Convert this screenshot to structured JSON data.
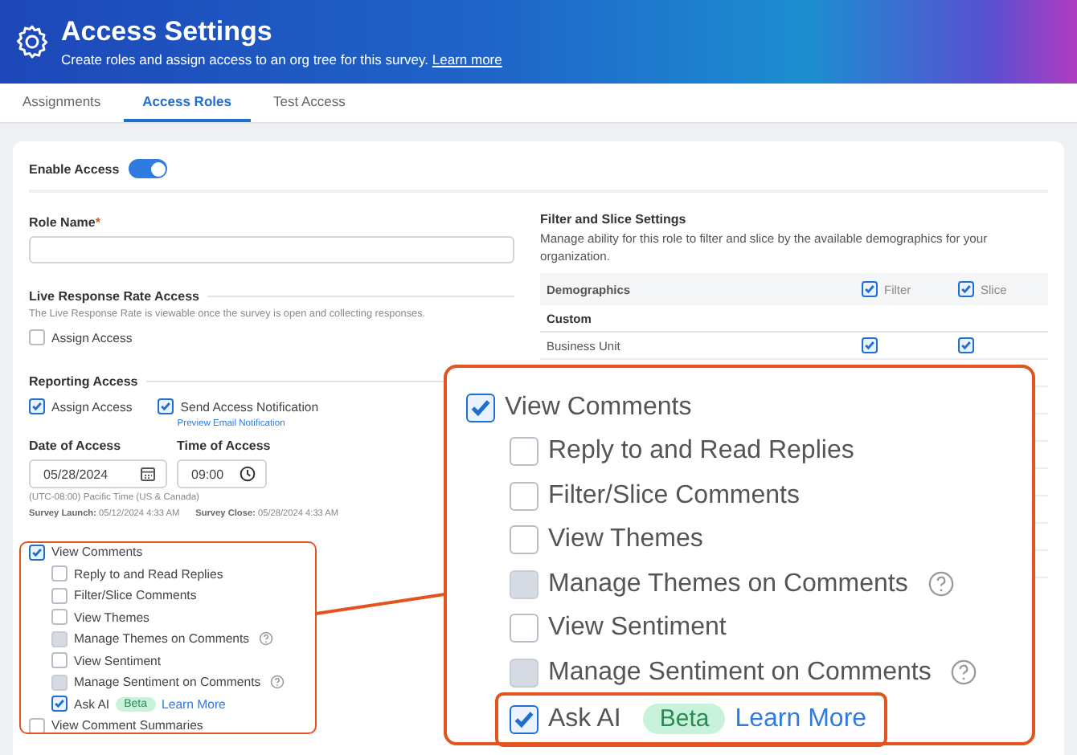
{
  "header": {
    "title": "Access Settings",
    "subtitle": "Create roles and assign access to an org tree for this survey.",
    "link": "Learn more"
  },
  "tabs": [
    {
      "label": "Assignments",
      "selected": false
    },
    {
      "label": "Access Roles",
      "selected": true
    },
    {
      "label": "Test Access",
      "selected": false
    }
  ],
  "enable_access": {
    "label": "Enable Access",
    "on": true
  },
  "role_name": {
    "label": "Role Name",
    "required_mark": "*"
  },
  "live_response": {
    "title": "Live Response Rate Access",
    "description": "The Live Response Rate is viewable once the survey is open and collecting responses.",
    "checkbox": {
      "label": "Assign Access",
      "checked": false
    }
  },
  "reporting_access": {
    "title": "Reporting Access",
    "checkboxes": [
      {
        "label": "Assign Access",
        "checked": true
      },
      {
        "label": "Send Access Notification",
        "checked": true
      }
    ],
    "preview_link": "Preview Email Notification",
    "date": {
      "label": "Date of Access",
      "value": "05/28/2024"
    },
    "time": {
      "label": "Time of Access",
      "value": "09:00"
    },
    "timezone": "(UTC-08:00) Pacific Time (US & Canada)",
    "launch": {
      "label": "Survey Launch:",
      "value": "05/12/2024 4:33 AM"
    },
    "close": {
      "label": "Survey Close:",
      "value": "05/28/2024 4:33 AM"
    }
  },
  "permissions": {
    "label": "View Comments",
    "checked": true,
    "children": [
      {
        "label": "Reply to and Read Replies",
        "checked": false,
        "disabled": false,
        "help": false
      },
      {
        "label": "Filter/Slice Comments",
        "checked": false,
        "disabled": false,
        "help": false
      },
      {
        "label": "View Themes",
        "checked": false,
        "disabled": false,
        "help": false
      },
      {
        "label": "Manage Themes on Comments",
        "checked": false,
        "disabled": true,
        "help": true
      },
      {
        "label": "View Sentiment",
        "checked": false,
        "disabled": false,
        "help": false
      },
      {
        "label": "Manage Sentiment on Comments",
        "checked": false,
        "disabled": true,
        "help": true
      },
      {
        "label": "Ask AI",
        "checked": true,
        "disabled": false,
        "help": false,
        "badge": "Beta",
        "link": "Learn More"
      }
    ]
  },
  "summaries": {
    "label": "View Comment Summaries",
    "checked": false
  },
  "filter_slice": {
    "title": "Filter and Slice Settings",
    "description": "Manage ability for this role to filter and slice by the available demographics for your organization.",
    "header": {
      "label": "Demographics",
      "filter": {
        "label": "Filter",
        "checked": true
      },
      "slice": {
        "label": "Slice",
        "checked": true
      }
    },
    "groups": [
      {
        "name": "Custom",
        "rows": [
          {
            "name": "Business Unit",
            "filter": true,
            "slice": true
          }
        ]
      }
    ]
  },
  "callout": {
    "label": "View Comments",
    "checked": true,
    "children": [
      {
        "label": "Reply to and Read Replies",
        "checked": false,
        "disabled": false,
        "help": false
      },
      {
        "label": "Filter/Slice Comments",
        "checked": false,
        "disabled": false,
        "help": false
      },
      {
        "label": "View Themes",
        "checked": false,
        "disabled": false,
        "help": false
      },
      {
        "label": "Manage Themes on Comments",
        "checked": false,
        "disabled": true,
        "help": true
      },
      {
        "label": "View Sentiment",
        "checked": false,
        "disabled": false,
        "help": false
      },
      {
        "label": "Manage Sentiment on Comments",
        "checked": false,
        "disabled": true,
        "help": true
      },
      {
        "label": "Ask AI",
        "checked": true,
        "disabled": false,
        "help": false,
        "badge": "Beta",
        "link": "Learn More"
      }
    ]
  }
}
